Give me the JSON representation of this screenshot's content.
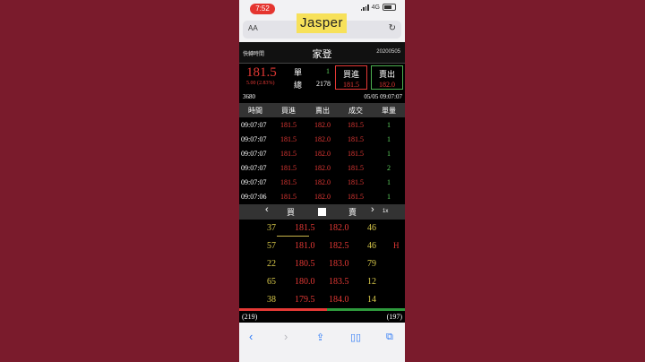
{
  "status": {
    "time": "7:52",
    "network": "4G"
  },
  "browser": {
    "aa_label": "AA",
    "reload_icon": "reload-icon"
  },
  "overlay": {
    "text": "Jasper"
  },
  "header": {
    "quick_label": "快轉時間",
    "stock_name": "家登",
    "date": "20200505"
  },
  "summary": {
    "price": "181.5",
    "change": "5.00 (2.83%)",
    "single_label": "單",
    "single_value": "1",
    "total_label": "總",
    "total_value": "2178",
    "buy_label": "買進",
    "buy_price": "181.5",
    "sell_label": "賣出",
    "sell_price": "182.0",
    "volume": "3680",
    "timestamp": "05/05 09:07:07"
  },
  "ticks": {
    "headers": [
      "時間",
      "買進",
      "賣出",
      "成交",
      "單量"
    ],
    "rows": [
      [
        "09:07:07",
        "181.5",
        "182.0",
        "181.5",
        "1"
      ],
      [
        "09:07:07",
        "181.5",
        "182.0",
        "181.5",
        "1"
      ],
      [
        "09:07:07",
        "181.5",
        "182.0",
        "181.5",
        "1"
      ],
      [
        "09:07:07",
        "181.5",
        "182.0",
        "181.5",
        "2"
      ],
      [
        "09:07:07",
        "181.5",
        "182.0",
        "181.5",
        "1"
      ],
      [
        "09:07:06",
        "181.5",
        "182.0",
        "181.5",
        "1"
      ]
    ]
  },
  "depth_nav": {
    "buy_label": "買",
    "sell_label": "賣",
    "speed": "1x"
  },
  "depth": {
    "rows": [
      [
        "37",
        "181.5",
        "182.0",
        "46"
      ],
      [
        "57",
        "181.0",
        "182.5",
        "46"
      ],
      [
        "22",
        "180.5",
        "183.0",
        "79"
      ],
      [
        "65",
        "180.0",
        "183.5",
        "12"
      ],
      [
        "38",
        "179.5",
        "184.0",
        "14"
      ]
    ],
    "high_marker": "H",
    "buy_total": "(219)",
    "sell_total": "(197)"
  },
  "colors": {
    "up": "#e53935",
    "flat": "#d9c94a",
    "green": "#5fd35f",
    "background": "#7a1b2c"
  }
}
